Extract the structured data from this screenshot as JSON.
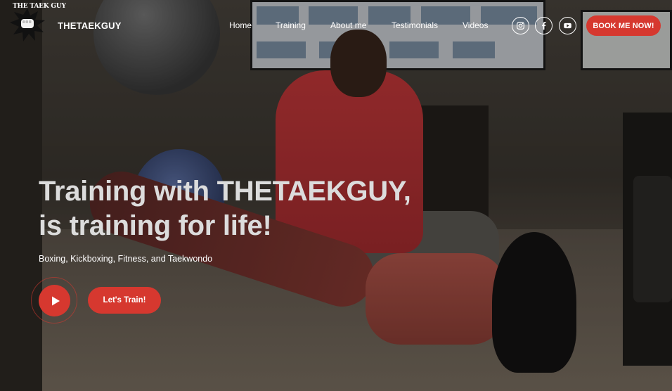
{
  "logo": {
    "text": "THE TAEK GUY"
  },
  "header": {
    "brand": "THETAEKGUY",
    "nav": [
      {
        "label": "Home"
      },
      {
        "label": "Training"
      },
      {
        "label": "About me"
      },
      {
        "label": "Testimonials"
      },
      {
        "label": "Videos"
      }
    ],
    "social": [
      {
        "icon": "instagram-icon"
      },
      {
        "icon": "facebook-icon"
      },
      {
        "icon": "youtube-icon"
      }
    ],
    "cta_label": "BOOK ME NOW!"
  },
  "hero": {
    "headline_line1": "Training with THETAEKGUY,",
    "headline_line2": "is training for life!",
    "subtitle": "Boxing, Kickboxing, Fitness, and Taekwondo",
    "play_icon": "play-icon",
    "button_label": "Let's Train!"
  },
  "colors": {
    "accent": "#d6382f",
    "headline": "#dcdcdc",
    "text": "#ffffff"
  }
}
